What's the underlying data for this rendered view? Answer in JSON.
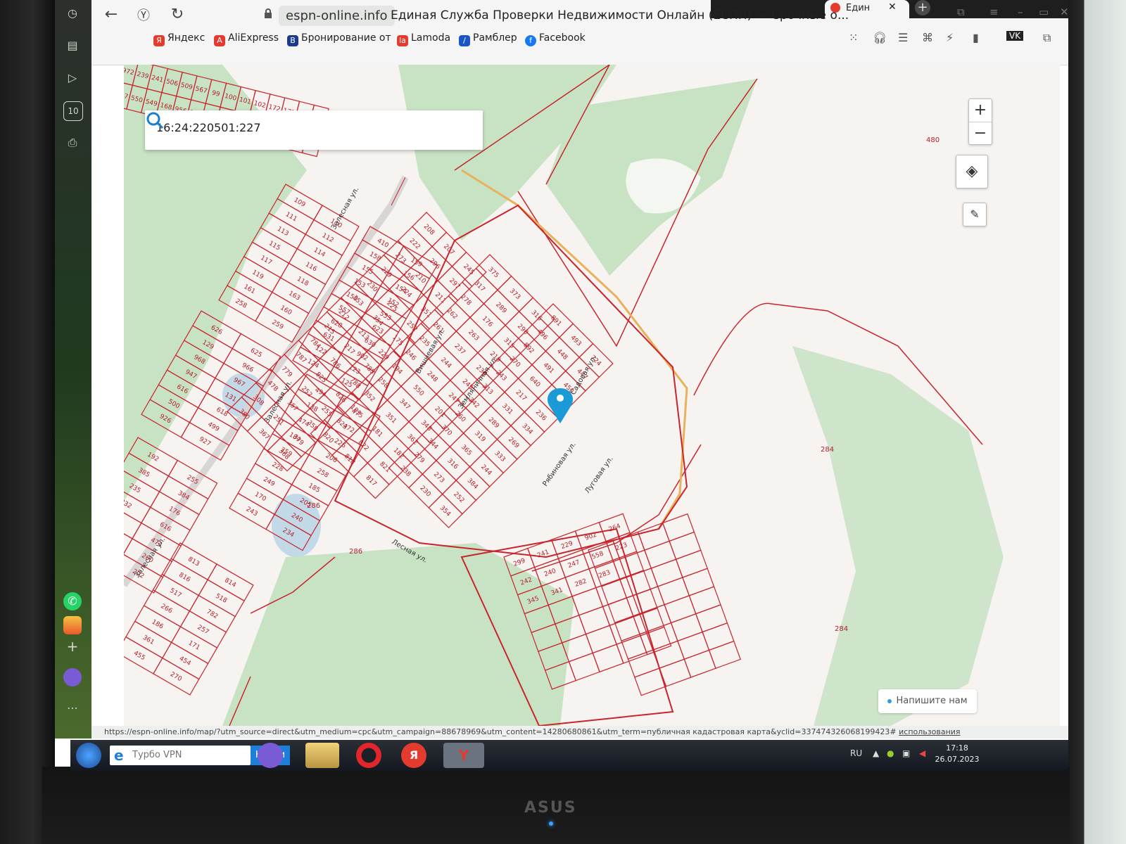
{
  "browser": {
    "domain": "espn-online.info",
    "page_title": "Единая Служба Проверки Недвижимости Онлайн (ЕСПН) — Срочные о...",
    "tab_title": "Един",
    "tab_close": "✕",
    "sidebar_badge": "10",
    "bookmarks": [
      {
        "label": "Яндекс",
        "icon": "yandex-icon",
        "color": "#e43b2f",
        "glyph": "Я"
      },
      {
        "label": "AliExpress",
        "icon": "aliexpress-icon",
        "color": "#e43b2f",
        "glyph": "A"
      },
      {
        "label": "Бронирование от",
        "icon": "booking-icon",
        "color": "#1a3b8c",
        "glyph": "B"
      },
      {
        "label": "Lamoda",
        "icon": "lamoda-icon",
        "color": "#e43b2f",
        "glyph": "la"
      },
      {
        "label": "Рамблер",
        "icon": "rambler-icon",
        "color": "#1a56c6",
        "glyph": "/"
      },
      {
        "label": "Facebook",
        "icon": "facebook-icon",
        "color": "#1877f2",
        "glyph": "f"
      }
    ],
    "status_url": "https://espn-online.info/map/?utm_source=direct&utm_medium=cpc&utm_campaign=88678969&utm_content=14280680861&utm_term=публичная кадастровая карта&yclid=337474326068199423#",
    "status_link": "использования"
  },
  "map": {
    "search_value": "16:24:220501:227",
    "zoom_in": "+",
    "zoom_out": "−",
    "chat_label": "Напишите нам",
    "streets": [
      "Залесная ул.",
      "Залесная ул.",
      "Залесная ул.",
      "Вишневая ул.",
      "Земляничная ул.",
      "Садовая ул.",
      "Рябиновая ул.",
      "Лесная ул.",
      "Луговая ул."
    ],
    "big_parcels": [
      "480",
      "284",
      "284",
      "286",
      "286"
    ],
    "parcel_numbers": [
      "972",
      "239",
      "241",
      "506",
      "509",
      "567",
      "99",
      "100",
      "101",
      "102",
      "172",
      "171",
      "173",
      "548",
      "547",
      "550",
      "549",
      "168",
      "956",
      "955",
      "935",
      "934",
      "103",
      "104",
      "105",
      "106",
      "107",
      "108",
      "109",
      "110",
      "111",
      "112",
      "113",
      "114",
      "115",
      "116",
      "117",
      "118",
      "119",
      "163",
      "161",
      "160",
      "258",
      "259",
      "410",
      "159",
      "158",
      "156",
      "155",
      "154",
      "153",
      "152",
      "150",
      "553",
      "557",
      "623",
      "628",
      "630",
      "631",
      "902",
      "122",
      "123",
      "124",
      "125",
      "626",
      "625",
      "129",
      "966",
      "968",
      "967",
      "947",
      "131",
      "616",
      "618",
      "500",
      "499",
      "926",
      "927",
      "494",
      "475",
      "138",
      "472",
      "474",
      "226",
      "184",
      "206",
      "259",
      "258",
      "228",
      "185",
      "249",
      "205",
      "170",
      "240",
      "243",
      "234",
      "192",
      "255",
      "385",
      "384",
      "235",
      "176",
      "232",
      "616",
      "475",
      "474",
      "250",
      "260",
      "257",
      "202",
      "813",
      "814",
      "816",
      "518",
      "517",
      "782",
      "266",
      "257",
      "186",
      "171",
      "361",
      "454",
      "455",
      "270",
      "208",
      "207",
      "245",
      "222",
      "296",
      "297",
      "273",
      "210",
      "211",
      "229",
      "224",
      "351",
      "230",
      "225",
      "252",
      "353",
      "354",
      "175",
      "212",
      "213",
      "229",
      "215",
      "217",
      "785",
      "784",
      "786",
      "788",
      "787",
      "825",
      "826",
      "779",
      "252",
      "255",
      "478",
      "357",
      "358",
      "308",
      "251",
      "379",
      "380",
      "367",
      "368",
      "375",
      "373",
      "316",
      "317",
      "289",
      "290",
      "278",
      "176",
      "315",
      "262",
      "263",
      "219",
      "261",
      "237",
      "236",
      "235",
      "244",
      "245",
      "246",
      "248",
      "247",
      "194",
      "550",
      "201",
      "258",
      "347",
      "348",
      "352",
      "351",
      "362",
      "183",
      "181",
      "182",
      "823",
      "822",
      "821",
      "820",
      "818",
      "817",
      "891",
      "493",
      "724",
      "496",
      "448",
      "447",
      "892",
      "491",
      "450",
      "270",
      "640",
      "643",
      "243",
      "217",
      "236",
      "313",
      "331",
      "334",
      "342",
      "289",
      "269",
      "260",
      "319",
      "333",
      "370",
      "365",
      "244",
      "344",
      "316",
      "384",
      "279",
      "273",
      "252",
      "238",
      "230",
      "354",
      "299",
      "241",
      "229",
      "902",
      "264",
      "242",
      "240",
      "247",
      "558",
      "223",
      "345",
      "341",
      "282",
      "283"
    ]
  },
  "taskbar": {
    "vpn_placeholder": "Турбо VPN",
    "vpn_button": "Найти",
    "lang": "RU",
    "time": "17:18",
    "date": "26.07.2023"
  },
  "monitor": {
    "brand": "ASUS"
  }
}
